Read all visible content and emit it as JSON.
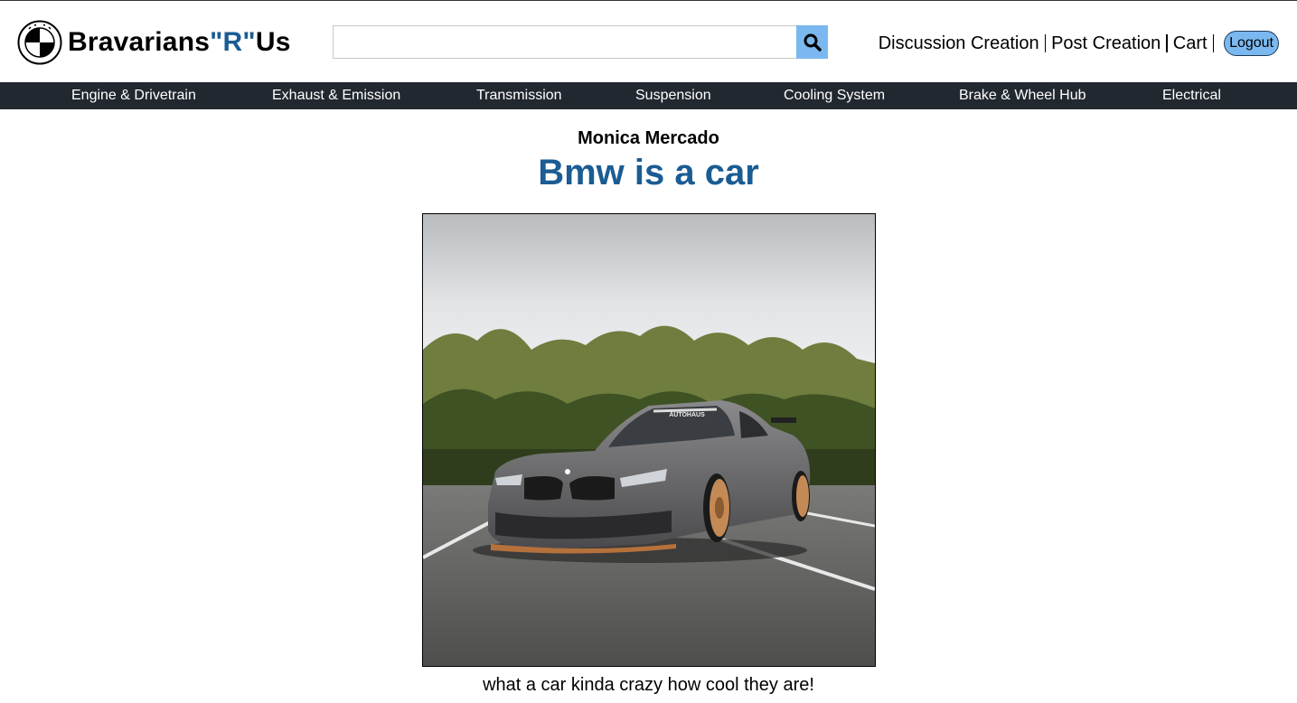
{
  "header": {
    "brand_main": "Bravarians",
    "brand_accent": "\"R\"",
    "brand_tail": "Us",
    "logo_icon": "bmw-roundel-icon",
    "search": {
      "value": "",
      "placeholder": ""
    },
    "links": {
      "discussion_creation": "Discussion Creation",
      "post_creation": "Post Creation",
      "cart": "Cart",
      "logout": "Logout"
    }
  },
  "nav": {
    "items": [
      "Engine & Drivetrain",
      "Exhaust & Emission",
      "Transmission",
      "Suspension",
      "Cooling System",
      "Brake & Wheel Hub",
      "Electrical"
    ]
  },
  "post": {
    "author": "Monica Mercado",
    "title": "Bmw is a car",
    "image_text": "AUTOHAUS",
    "caption": "what a car kinda crazy how cool they are!"
  },
  "colors": {
    "accent": "#1a5c93",
    "button": "#7ab8ef",
    "navbar": "#222830"
  }
}
